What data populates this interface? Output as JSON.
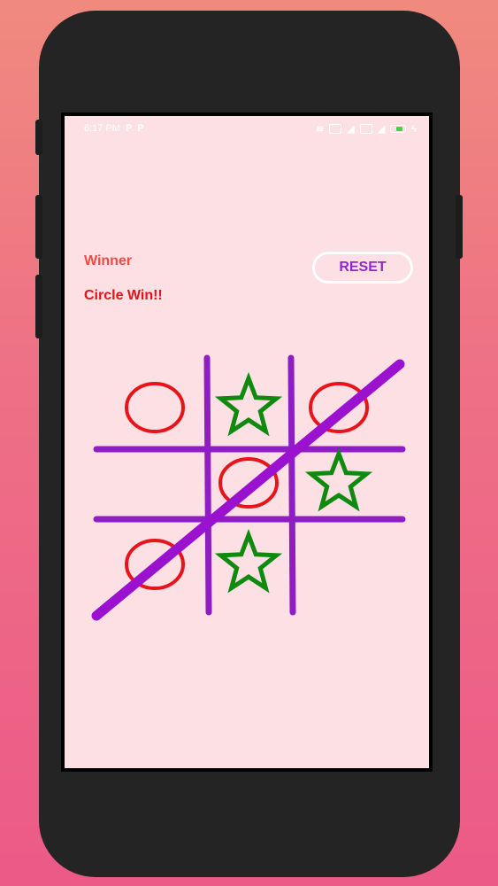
{
  "status_bar": {
    "time": "6:17 PM",
    "notification_icons": [
      "p-icon",
      "p-icon"
    ],
    "right_icons": [
      "wifi-icon",
      "sim-icon",
      "signal-icon",
      "sim-icon",
      "signal-icon"
    ],
    "battery_color": "#41d641"
  },
  "game": {
    "winner_label": "Winner",
    "winner_value": "Circle Win!!",
    "reset_label": "RESET",
    "board": [
      [
        "circle",
        "star",
        "circle"
      ],
      [
        "",
        "circle",
        "star"
      ],
      [
        "circle",
        "star",
        ""
      ]
    ],
    "winning_line": "anti-diagonal",
    "colors": {
      "circle": "#e8141c",
      "star": "#0f8a0f",
      "grid": "#8e1dc4",
      "win_line": "#9a12d0",
      "background": "#fde0e4",
      "reset_text": "#9029c9"
    }
  }
}
